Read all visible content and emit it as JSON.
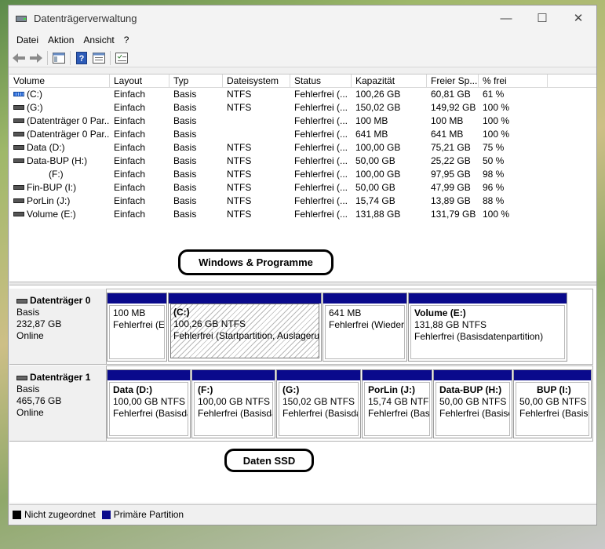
{
  "window": {
    "title": "Datenträgerverwaltung"
  },
  "menu": [
    "Datei",
    "Aktion",
    "Ansicht",
    "?"
  ],
  "columns": [
    "Volume",
    "Layout",
    "Typ",
    "Dateisystem",
    "Status",
    "Kapazität",
    "Freier Sp...",
    "% frei",
    ""
  ],
  "volumes": [
    {
      "volume": "(C:)",
      "layout": "Einfach",
      "typ": "Basis",
      "fs": "NTFS",
      "status": "Fehlerfrei (...",
      "cap": "100,26 GB",
      "free": "60,81 GB",
      "pct": "61 %",
      "icon": "system-volume-icon"
    },
    {
      "volume": "(G:)",
      "layout": "Einfach",
      "typ": "Basis",
      "fs": "NTFS",
      "status": "Fehlerfrei (...",
      "cap": "150,02 GB",
      "free": "149,92 GB",
      "pct": "100 %",
      "icon": "volume-icon"
    },
    {
      "volume": "(Datenträger 0 Par...",
      "layout": "Einfach",
      "typ": "Basis",
      "fs": "",
      "status": "Fehlerfrei (...",
      "cap": "100 MB",
      "free": "100 MB",
      "pct": "100 %",
      "icon": "volume-icon"
    },
    {
      "volume": "(Datenträger 0 Par...",
      "layout": "Einfach",
      "typ": "Basis",
      "fs": "",
      "status": "Fehlerfrei (...",
      "cap": "641 MB",
      "free": "641 MB",
      "pct": "100 %",
      "icon": "volume-icon"
    },
    {
      "volume": "Data (D:)",
      "layout": "Einfach",
      "typ": "Basis",
      "fs": "NTFS",
      "status": "Fehlerfrei (...",
      "cap": "100,00 GB",
      "free": "75,21 GB",
      "pct": "75 %",
      "icon": "volume-icon"
    },
    {
      "volume": "Data-BUP (H:)",
      "layout": "Einfach",
      "typ": "Basis",
      "fs": "NTFS",
      "status": "Fehlerfrei (...",
      "cap": "50,00 GB",
      "free": "25,22 GB",
      "pct": "50 %",
      "icon": "volume-icon"
    },
    {
      "volume": "(F:)",
      "layout": "Einfach",
      "typ": "Basis",
      "fs": "NTFS",
      "status": "Fehlerfrei (...",
      "cap": "100,00 GB",
      "free": "97,95 GB",
      "pct": "98 %",
      "icon": ""
    },
    {
      "volume": "Fin-BUP (I:)",
      "layout": "Einfach",
      "typ": "Basis",
      "fs": "NTFS",
      "status": "Fehlerfrei (...",
      "cap": "50,00 GB",
      "free": "47,99 GB",
      "pct": "96 %",
      "icon": "volume-icon"
    },
    {
      "volume": "PorLin (J:)",
      "layout": "Einfach",
      "typ": "Basis",
      "fs": "NTFS",
      "status": "Fehlerfrei (...",
      "cap": "15,74 GB",
      "free": "13,89 GB",
      "pct": "88 %",
      "icon": "volume-icon"
    },
    {
      "volume": "Volume (E:)",
      "layout": "Einfach",
      "typ": "Basis",
      "fs": "NTFS",
      "status": "Fehlerfrei (...",
      "cap": "131,88 GB",
      "free": "131,79 GB",
      "pct": "100 %",
      "icon": "volume-icon"
    }
  ],
  "annotations": {
    "top": "Windows & Programme",
    "bottom": "Daten SSD"
  },
  "disks": [
    {
      "name": "Datenträger 0",
      "type": "Basis",
      "size": "232,87 GB",
      "status": "Online",
      "partitions": [
        {
          "name": "",
          "line1": "100 MB",
          "line2": "Fehlerfrei (E"
        },
        {
          "name": "(C:)",
          "line1": "100,26 GB NTFS",
          "line2": "Fehlerfrei (Startpartition, Auslageru"
        },
        {
          "name": "",
          "line1": "641 MB",
          "line2": "Fehlerfrei (Wieder"
        },
        {
          "name": "Volume  (E:)",
          "line1": "131,88 GB NTFS",
          "line2": "Fehlerfrei (Basisdatenpartition)"
        }
      ]
    },
    {
      "name": "Datenträger 1",
      "type": "Basis",
      "size": "465,76 GB",
      "status": "Online",
      "partitions": [
        {
          "name": "Data  (D:)",
          "line1": "100,00 GB NTFS",
          "line2": "Fehlerfrei (Basisda"
        },
        {
          "name": "(F:)",
          "line1": "100,00 GB NTFS",
          "line2": "Fehlerfrei (Basisda"
        },
        {
          "name": "(G:)",
          "line1": "150,02 GB NTFS",
          "line2": "Fehlerfrei (Basisda"
        },
        {
          "name": "PorLin  (J:)",
          "line1": "15,74 GB NTFS",
          "line2": "Fehlerfrei (Bas"
        },
        {
          "name": "Data-BUP  (H:)",
          "line1": "50,00 GB NTFS",
          "line2": "Fehlerfrei (Basisc"
        },
        {
          "name": "BUP  (I:)",
          "line1": "50,00 GB NTFS",
          "line2": "Fehlerfrei (Basisd"
        }
      ]
    }
  ],
  "legend": [
    {
      "label": "Nicht zugeordnet",
      "color": "#000000"
    },
    {
      "label": "Primäre Partition",
      "color": "#0a0a8c"
    }
  ],
  "colors": {
    "partition_bar": "#0a0a8c"
  }
}
